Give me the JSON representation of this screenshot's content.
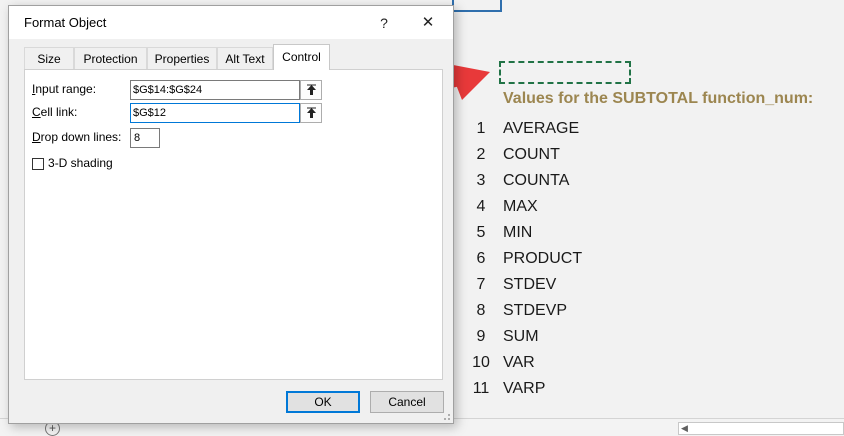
{
  "dialog": {
    "title": "Format Object",
    "help_label": "?",
    "close_label": "✕",
    "tabs": [
      {
        "label": "Size",
        "active": false
      },
      {
        "label": "Protection",
        "active": false
      },
      {
        "label": "Properties",
        "active": false
      },
      {
        "label": "Alt Text",
        "active": false
      },
      {
        "label": "Control",
        "active": true
      }
    ],
    "fields": {
      "input_range": {
        "label_first": "I",
        "label_rest": "nput range:",
        "value": "$G$14:$G$24"
      },
      "cell_link": {
        "label_first": "C",
        "label_rest": "ell link:",
        "value": "$G$12"
      },
      "drop_down_lines": {
        "label_first": "D",
        "label_rest": "rop down lines:",
        "value": "8"
      },
      "shading": {
        "label_first": "3",
        "label_rest": "-D shading",
        "checked": false
      }
    },
    "ok_label": "OK",
    "cancel_label": "Cancel"
  },
  "sheet": {
    "heading": "Values for the SUBTOTAL function_num:",
    "functions": [
      {
        "num": "1",
        "name": "AVERAGE"
      },
      {
        "num": "2",
        "name": "COUNT"
      },
      {
        "num": "3",
        "name": "COUNTA"
      },
      {
        "num": "4",
        "name": "MAX"
      },
      {
        "num": "5",
        "name": "MIN"
      },
      {
        "num": "6",
        "name": "PRODUCT"
      },
      {
        "num": "7",
        "name": "STDEV"
      },
      {
        "num": "8",
        "name": "STDEVP"
      },
      {
        "num": "9",
        "name": "SUM"
      },
      {
        "num": "10",
        "name": "VAR"
      },
      {
        "num": "11",
        "name": "VARP"
      }
    ],
    "add_sheet_label": "+"
  },
  "colors": {
    "heading": "#9c8650",
    "arrow": "#e8393a",
    "focus": "#0078d7",
    "marquee": "#217346"
  },
  "icons": [
    "collapse-dialog-icon",
    "close-icon",
    "help-icon",
    "add-sheet-icon",
    "scroll-left-icon",
    "annotation-arrow"
  ]
}
